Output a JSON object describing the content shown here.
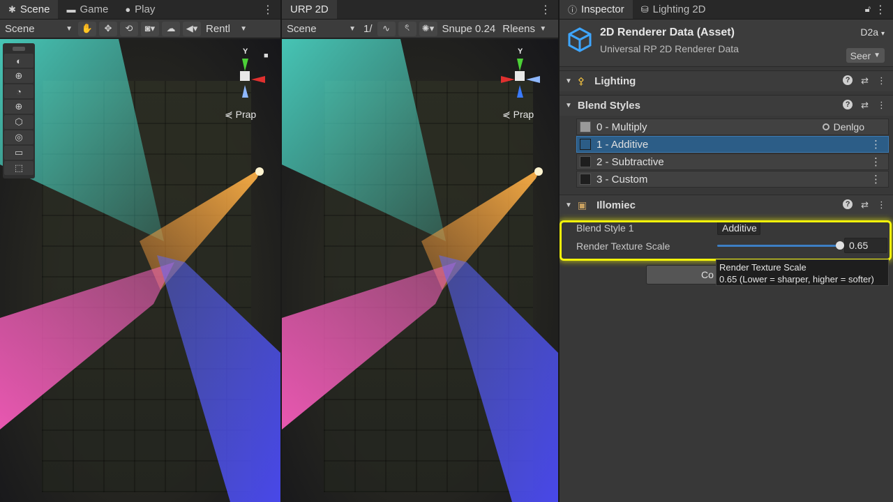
{
  "scene_pane": {
    "tabs": [
      {
        "label": "Scene",
        "icon": "scene-icon"
      },
      {
        "label": "Game",
        "icon": "game-icon"
      },
      {
        "label": "Play",
        "icon": "play-icon"
      }
    ],
    "toolbar": {
      "view_dropdown": "Scene",
      "render_dropdown": "Rentl"
    },
    "gizmo": {
      "y_label": "Y",
      "persp_label": "Prap"
    }
  },
  "urp_pane": {
    "tab_label": "URP 2D",
    "toolbar": {
      "view_dropdown": "Scene",
      "zoom_text": "1/",
      "shape_text": "Snupe 0.24",
      "render_dropdown": "Rleens"
    },
    "gizmo": {
      "y_label": "Y",
      "persp_label": "Prap"
    }
  },
  "inspector": {
    "tabs": [
      {
        "label": "Inspector",
        "icon": "info-icon"
      },
      {
        "label": "Lighting 2D",
        "icon": "cylinder-icon"
      }
    ],
    "asset": {
      "title": "2D Renderer Data (Asset)",
      "subtitle": "Universal RP 2D Renderer Data",
      "right_label": "D2a",
      "select_label": "Seer"
    },
    "sections": {
      "lighting": "Lighting",
      "blend_styles": "Blend Styles",
      "third": "Illomiec"
    },
    "blend_styles": [
      {
        "label": "0 - Multiply",
        "swatch": "#9a9a9a",
        "extra": "Denlgo"
      },
      {
        "label": "1 - Additive",
        "swatch": "#2c5d87",
        "selected": true
      },
      {
        "label": "2 - Subtractive",
        "swatch": "#1e1e1e"
      },
      {
        "label": "3 - Custom",
        "swatch": "#1e1e1e"
      }
    ],
    "properties": {
      "blend_style_label": "Blend Style 1",
      "blend_style_value": "Additive",
      "render_scale_label": "Render Texture Scale",
      "render_scale_value": "0.65",
      "render_scale_fraction": 0.65
    },
    "config_button": "Co",
    "tooltip": {
      "title": "Render Texture Scale",
      "body": "0.65 (Lower = sharper, higher = softer)"
    },
    "colors": {
      "highlight": "#f5f50a",
      "selection": "#2c5d87",
      "accent": "#3d7fc4"
    }
  }
}
